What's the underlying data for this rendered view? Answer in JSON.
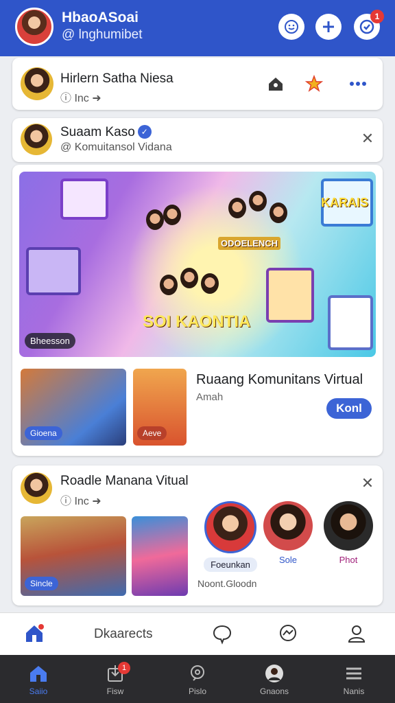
{
  "header": {
    "title": "HbaoASoai",
    "handle": "@ lnghumibet",
    "notification_count": "1",
    "icons": [
      "smile-icon",
      "plus-icon",
      "check-icon"
    ]
  },
  "card1": {
    "name": "Hirlern Satha Niesa",
    "sub": "Inc",
    "icons": [
      "home-icon",
      "star-icon",
      "more-icon"
    ]
  },
  "card2": {
    "name": "Suaam Kaso",
    "sub": "@ Komuitansol Vidana"
  },
  "card3": {
    "banner_signs": [
      "KARAIS",
      "ODOELENCH",
      "SOI KAONTIA"
    ],
    "banner_label": "Bheesson",
    "thumb1_tag": "Gioena",
    "thumb2_tag": "Aeve",
    "headline": "Ruaang Komunitans Virtual",
    "sub": "Amah",
    "button": "Konl"
  },
  "card4": {
    "name": "Roadle Manana Vitual",
    "sub": "Inc",
    "thumb_tag": "Sincle",
    "people": [
      {
        "label": "Foeunkan"
      },
      {
        "label": "Sole"
      },
      {
        "label": "Phot"
      }
    ],
    "footer": "Noont.Gloodn"
  },
  "tabbar": {
    "label": "Dkaarects"
  },
  "bottom_nav": {
    "items": [
      {
        "label": "Saiio",
        "icon": "home-icon"
      },
      {
        "label": "Fisw",
        "icon": "download-icon",
        "badge": "1"
      },
      {
        "label": "Pislo",
        "icon": "search-icon"
      },
      {
        "label": "Gnaons",
        "icon": "profile-icon"
      },
      {
        "label": "Nanis",
        "icon": "menu-icon"
      }
    ]
  },
  "colors": {
    "header_bg": "#2f55c9",
    "accent": "#3c64d6",
    "badge": "#e53935",
    "nav_bg": "#2b2b2e"
  }
}
